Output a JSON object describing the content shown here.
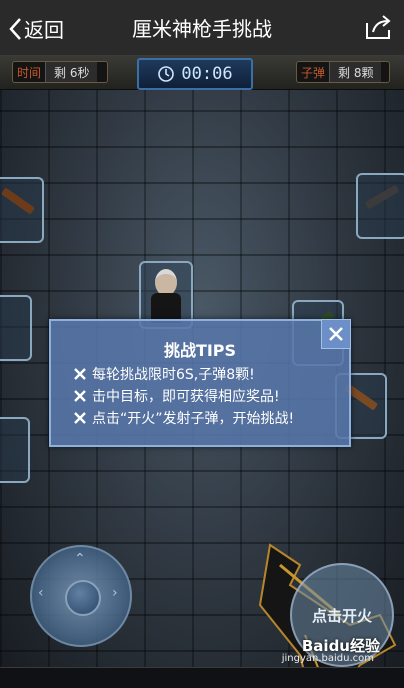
{
  "nav": {
    "back_label": "返回",
    "title": "厘米神枪手挑战",
    "share_icon": "share-icon"
  },
  "hud": {
    "time_label": "时间",
    "time_value": "剩 6秒",
    "timer": "00:06",
    "ammo_label": "子弹",
    "ammo_value": "剩 8颗"
  },
  "dialog": {
    "title": "挑战TIPS",
    "tips": [
      "每轮挑战限时6S,子弹8颗!",
      "击中目标，即可获得相应奖品!",
      "点击“开火”发射子弹，开始挑战!"
    ]
  },
  "controls": {
    "fire_label": "点击开火"
  },
  "watermark": {
    "brand": "Baidu经验",
    "url": "jingyan.baidu.com"
  },
  "colors": {
    "hud_label": "#c35a2c",
    "timer_bg": "#1f3a5c",
    "dialog_bg": "#5876aa"
  }
}
